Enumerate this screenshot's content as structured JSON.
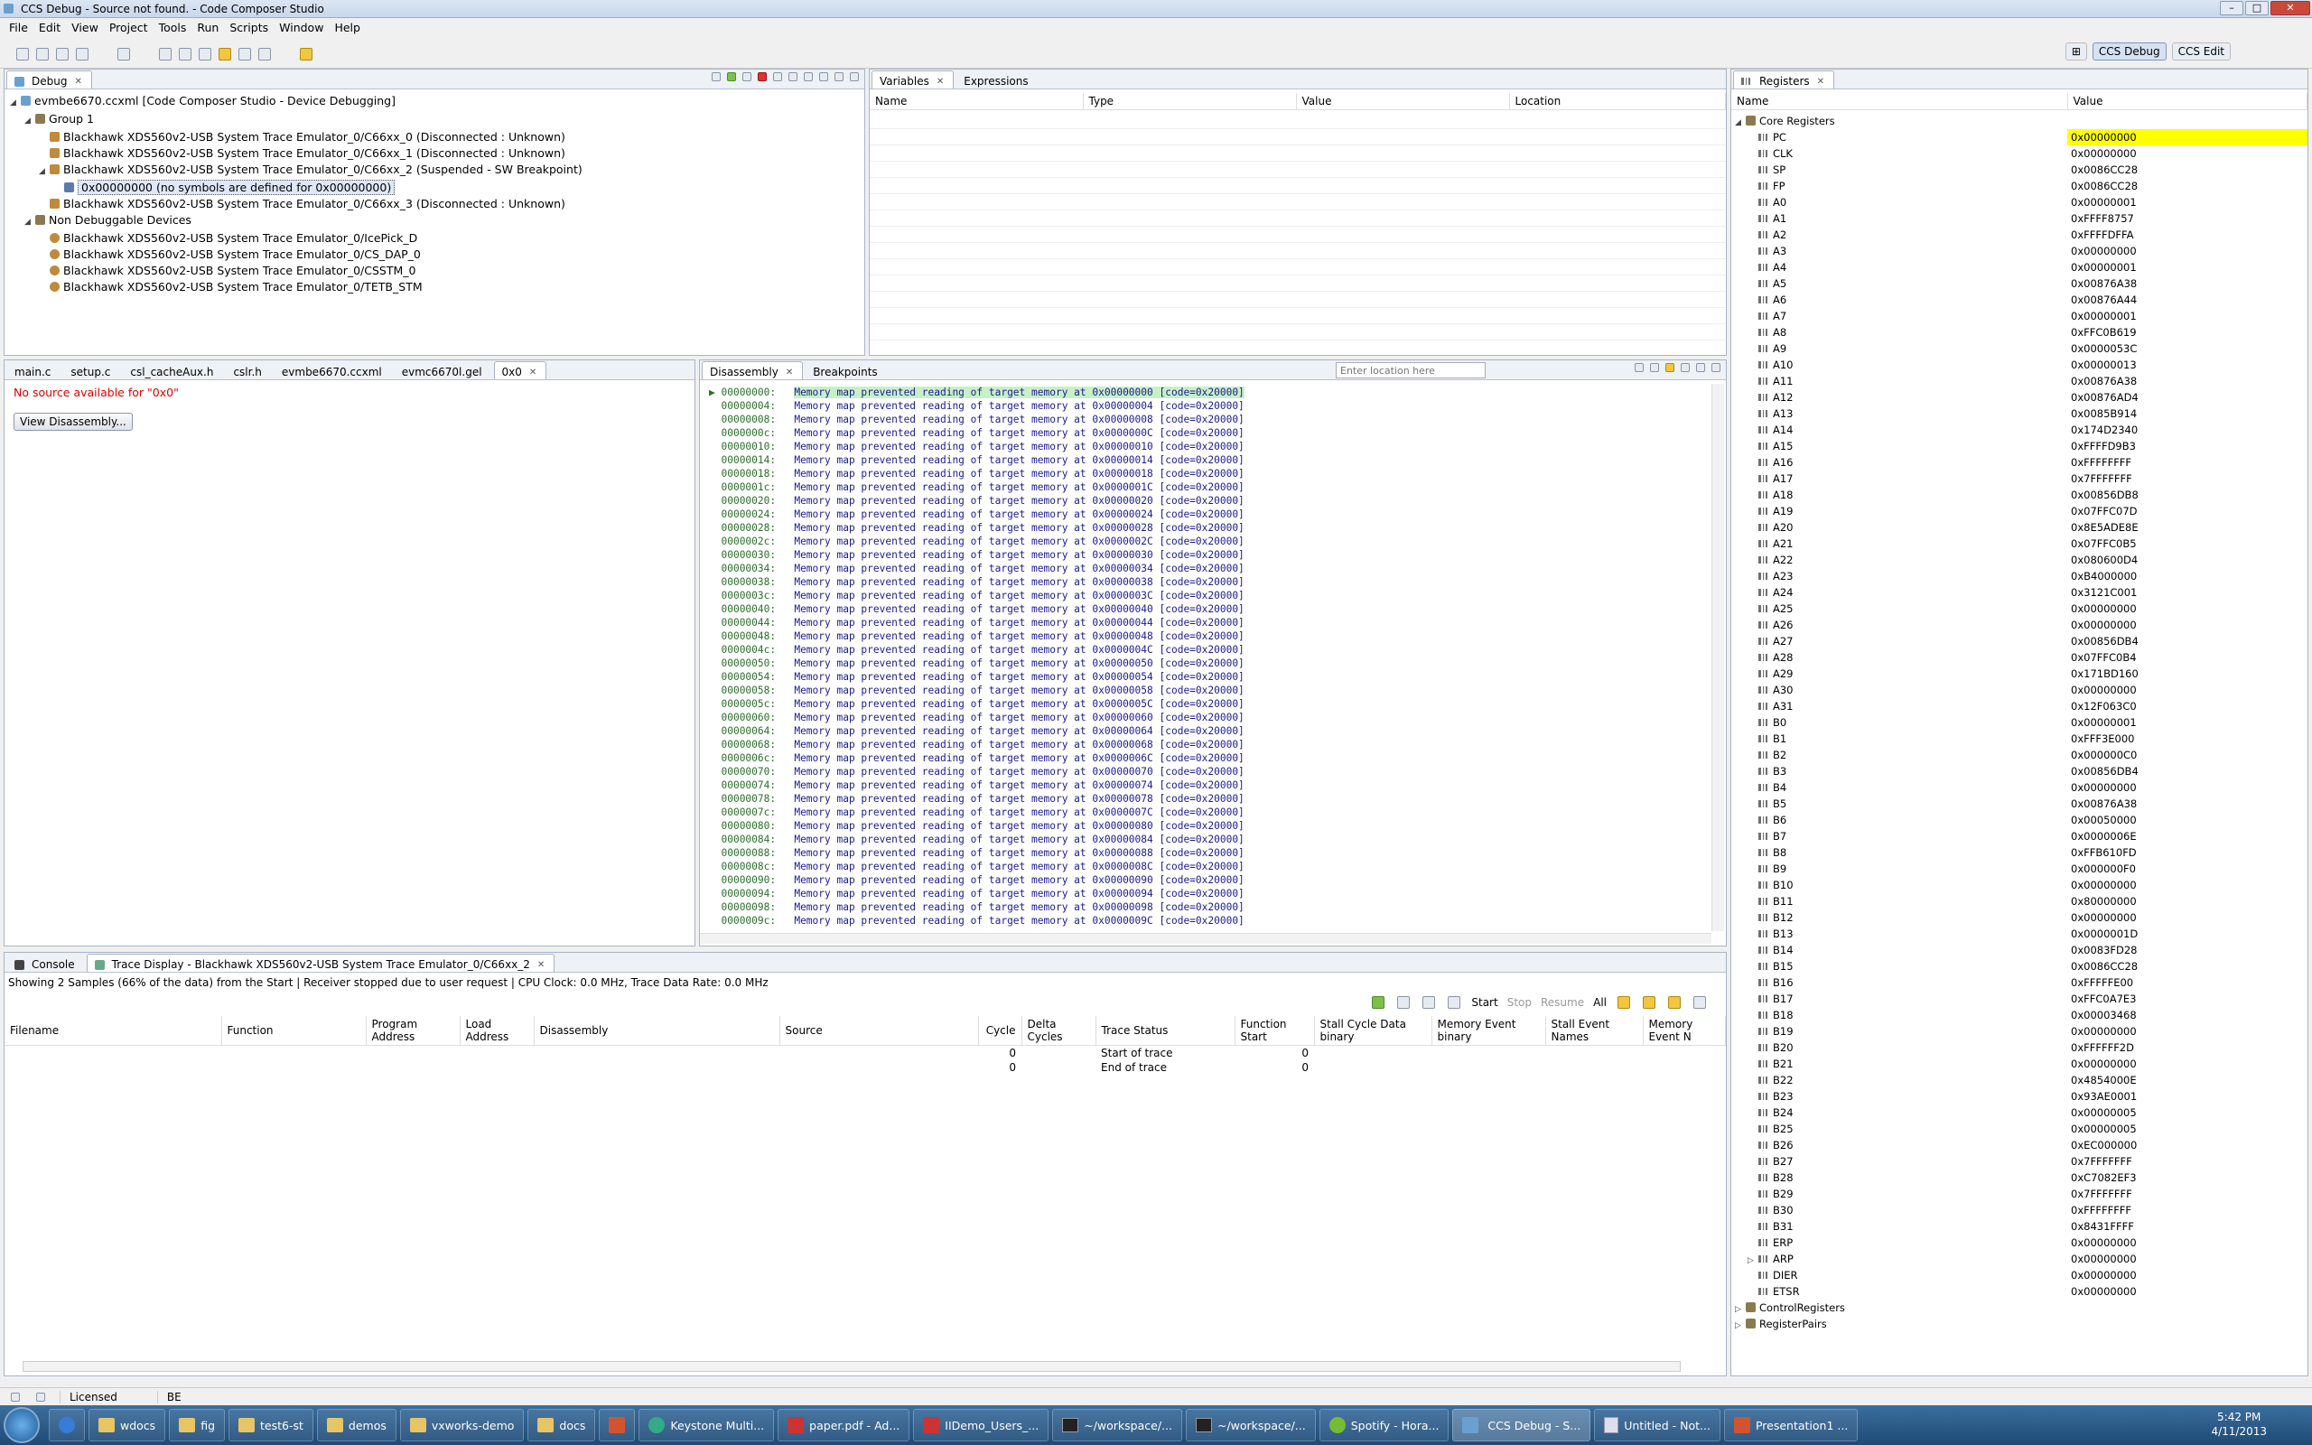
{
  "window": {
    "title": "CCS Debug - Source not found. - Code Composer Studio"
  },
  "menu": [
    "File",
    "Edit",
    "View",
    "Project",
    "Tools",
    "Run",
    "Scripts",
    "Window",
    "Help"
  ],
  "perspectives": {
    "debug": "CCS Debug",
    "edit": "CCS Edit"
  },
  "debug": {
    "tab": "Debug",
    "root": "evmbe6670.ccxml [Code Composer Studio - Device Debugging]",
    "group": "Group 1",
    "devices": [
      "Blackhawk XDS560v2-USB System Trace Emulator_0/C66xx_0 (Disconnected : Unknown)",
      "Blackhawk XDS560v2-USB System Trace Emulator_0/C66xx_1 (Disconnected : Unknown)",
      "Blackhawk XDS560v2-USB System Trace Emulator_0/C66xx_2 (Suspended - SW Breakpoint)"
    ],
    "frame": "0x00000000  (no symbols are defined for 0x00000000)",
    "device3": "Blackhawk XDS560v2-USB System Trace Emulator_0/C66xx_3 (Disconnected : Unknown)",
    "nondebug": "Non Debuggable Devices",
    "nondevices": [
      "Blackhawk XDS560v2-USB System Trace Emulator_0/IcePick_D",
      "Blackhawk XDS560v2-USB System Trace Emulator_0/CS_DAP_0",
      "Blackhawk XDS560v2-USB System Trace Emulator_0/CSSTM_0",
      "Blackhawk XDS560v2-USB System Trace Emulator_0/TETB_STM"
    ]
  },
  "variables": {
    "tab1": "Variables",
    "tab2": "Expressions",
    "cols": [
      "Name",
      "Type",
      "Value",
      "Location"
    ]
  },
  "editor": {
    "tabs": [
      "main.c",
      "setup.c",
      "csl_cacheAux.h",
      "cslr.h",
      "evmbe6670.ccxml",
      "evmc6670l.gel",
      "0x0"
    ],
    "nosource": "No source available for \"0x0\"",
    "button": "View Disassembly..."
  },
  "disasm": {
    "tab1": "Disassembly",
    "tab2": "Breakpoints",
    "location_placeholder": "Enter location here",
    "message": "Memory map prevented reading of target memory at",
    "code": "[code=0x20000]",
    "addrs": [
      "00000000",
      "00000004",
      "00000008",
      "0000000c",
      "00000010",
      "00000014",
      "00000018",
      "0000001c",
      "00000020",
      "00000024",
      "00000028",
      "0000002c",
      "00000030",
      "00000034",
      "00000038",
      "0000003c",
      "00000040",
      "00000044",
      "00000048",
      "0000004c",
      "00000050",
      "00000054",
      "00000058",
      "0000005c",
      "00000060",
      "00000064",
      "00000068",
      "0000006c",
      "00000070",
      "00000074",
      "00000078",
      "0000007c",
      "00000080",
      "00000084",
      "00000088",
      "0000008c",
      "00000090",
      "00000094",
      "00000098",
      "0000009c"
    ],
    "targets": [
      "0x00000000",
      "0x00000004",
      "0x00000008",
      "0x0000000C",
      "0x00000010",
      "0x00000014",
      "0x00000018",
      "0x0000001C",
      "0x00000020",
      "0x00000024",
      "0x00000028",
      "0x0000002C",
      "0x00000030",
      "0x00000034",
      "0x00000038",
      "0x0000003C",
      "0x00000040",
      "0x00000044",
      "0x00000048",
      "0x0000004C",
      "0x00000050",
      "0x00000054",
      "0x00000058",
      "0x0000005C",
      "0x00000060",
      "0x00000064",
      "0x00000068",
      "0x0000006C",
      "0x00000070",
      "0x00000074",
      "0x00000078",
      "0x0000007C",
      "0x00000080",
      "0x00000084",
      "0x00000088",
      "0x0000008C",
      "0x00000090",
      "0x00000094",
      "0x00000098",
      "0x0000009C"
    ]
  },
  "trace": {
    "tab1": "Console",
    "tab2": "Trace Display - Blackhawk XDS560v2-USB System Trace Emulator_0/C66xx_2",
    "info": "Showing 2 Samples (66% of the data) from the Start  |  Receiver stopped due to user request  |  CPU Clock: 0.0 MHz, Trace Data Rate: 0.0 MHz",
    "controls": [
      "Start",
      "Stop",
      "Resume",
      "All"
    ],
    "cols": [
      "Filename",
      "Function",
      "Program Address",
      "Load Address",
      "Disassembly",
      "Source",
      "Cycle",
      "Delta Cycles",
      "Trace Status",
      "Function Start",
      "Stall Cycle Data binary",
      "Memory Event binary",
      "Stall Event Names",
      "Memory Event N"
    ],
    "rows": [
      {
        "cycle": "0",
        "status": "Start of trace",
        "fstart": "0"
      },
      {
        "cycle": "0",
        "status": "End of trace",
        "fstart": "0"
      }
    ]
  },
  "registers": {
    "tab": "Registers",
    "cols": [
      "Name",
      "Value"
    ],
    "group": "Core Registers",
    "regs": [
      [
        "PC",
        "0x00000000"
      ],
      [
        "CLK",
        "0x00000000"
      ],
      [
        "SP",
        "0x0086CC28"
      ],
      [
        "FP",
        "0x0086CC28"
      ],
      [
        "A0",
        "0x00000001"
      ],
      [
        "A1",
        "0xFFFF8757"
      ],
      [
        "A2",
        "0xFFFFDFFA"
      ],
      [
        "A3",
        "0x00000000"
      ],
      [
        "A4",
        "0x00000001"
      ],
      [
        "A5",
        "0x00876A38"
      ],
      [
        "A6",
        "0x00876A44"
      ],
      [
        "A7",
        "0x00000001"
      ],
      [
        "A8",
        "0xFFC0B619"
      ],
      [
        "A9",
        "0x0000053C"
      ],
      [
        "A10",
        "0x00000013"
      ],
      [
        "A11",
        "0x00876A38"
      ],
      [
        "A12",
        "0x00876AD4"
      ],
      [
        "A13",
        "0x0085B914"
      ],
      [
        "A14",
        "0x174D2340"
      ],
      [
        "A15",
        "0xFFFFD9B3"
      ],
      [
        "A16",
        "0xFFFFFFFF"
      ],
      [
        "A17",
        "0x7FFFFFFF"
      ],
      [
        "A18",
        "0x00856DB8"
      ],
      [
        "A19",
        "0x07FFC07D"
      ],
      [
        "A20",
        "0x8E5ADE8E"
      ],
      [
        "A21",
        "0x07FFC0B5"
      ],
      [
        "A22",
        "0x080600D4"
      ],
      [
        "A23",
        "0xB4000000"
      ],
      [
        "A24",
        "0x3121C001"
      ],
      [
        "A25",
        "0x00000000"
      ],
      [
        "A26",
        "0x00000000"
      ],
      [
        "A27",
        "0x00856DB4"
      ],
      [
        "A28",
        "0x07FFC0B4"
      ],
      [
        "A29",
        "0x171BD160"
      ],
      [
        "A30",
        "0x00000000"
      ],
      [
        "A31",
        "0x12F063C0"
      ],
      [
        "B0",
        "0x00000001"
      ],
      [
        "B1",
        "0xFFF3E000"
      ],
      [
        "B2",
        "0x000000C0"
      ],
      [
        "B3",
        "0x00856DB4"
      ],
      [
        "B4",
        "0x00000000"
      ],
      [
        "B5",
        "0x00876A38"
      ],
      [
        "B6",
        "0x00050000"
      ],
      [
        "B7",
        "0x0000006E"
      ],
      [
        "B8",
        "0xFFB610FD"
      ],
      [
        "B9",
        "0x000000F0"
      ],
      [
        "B10",
        "0x00000000"
      ],
      [
        "B11",
        "0x80000000"
      ],
      [
        "B12",
        "0x00000000"
      ],
      [
        "B13",
        "0x0000001D"
      ],
      [
        "B14",
        "0x0083FD28"
      ],
      [
        "B15",
        "0x0086CC28"
      ],
      [
        "B16",
        "0xFFFFFE00"
      ],
      [
        "B17",
        "0xFFC0A7E3"
      ],
      [
        "B18",
        "0x00003468"
      ],
      [
        "B19",
        "0x00000000"
      ],
      [
        "B20",
        "0xFFFFFF2D"
      ],
      [
        "B21",
        "0x00000000"
      ],
      [
        "B22",
        "0x4854000E"
      ],
      [
        "B23",
        "0x93AE0001"
      ],
      [
        "B24",
        "0x00000005"
      ],
      [
        "B25",
        "0x00000005"
      ],
      [
        "B26",
        "0xEC000000"
      ],
      [
        "B27",
        "0x7FFFFFFF"
      ],
      [
        "B28",
        "0xC7082EF3"
      ],
      [
        "B29",
        "0x7FFFFFFF"
      ],
      [
        "B30",
        "0xFFFFFFFF"
      ],
      [
        "B31",
        "0x8431FFFF"
      ],
      [
        "ERP",
        "0x00000000"
      ],
      [
        "ARP",
        "0x00000000"
      ],
      [
        "DIER",
        "0x00000000"
      ],
      [
        "ETSR",
        "0x00000000"
      ]
    ],
    "groups": [
      "ControlRegisters",
      "RegisterPairs"
    ]
  },
  "status": {
    "license": "Licensed",
    "endian": "BE"
  },
  "taskbar": {
    "items": [
      "wdocs",
      "fig",
      "test6-st",
      "demos",
      "vxworks-demo",
      "docs",
      "Keystone Multi...",
      "paper.pdf - Ad...",
      "IIDemo_Users_...",
      "~/workspace/...",
      "~/workspace/...",
      "Spotify - Hora...",
      "CCS Debug - S...",
      "Untitled - Not...",
      "Presentation1 ..."
    ],
    "time": "5:42 PM",
    "date": "4/11/2013"
  },
  "colors": {
    "highlight": "#ffff00",
    "accent": "#1e4a75"
  }
}
